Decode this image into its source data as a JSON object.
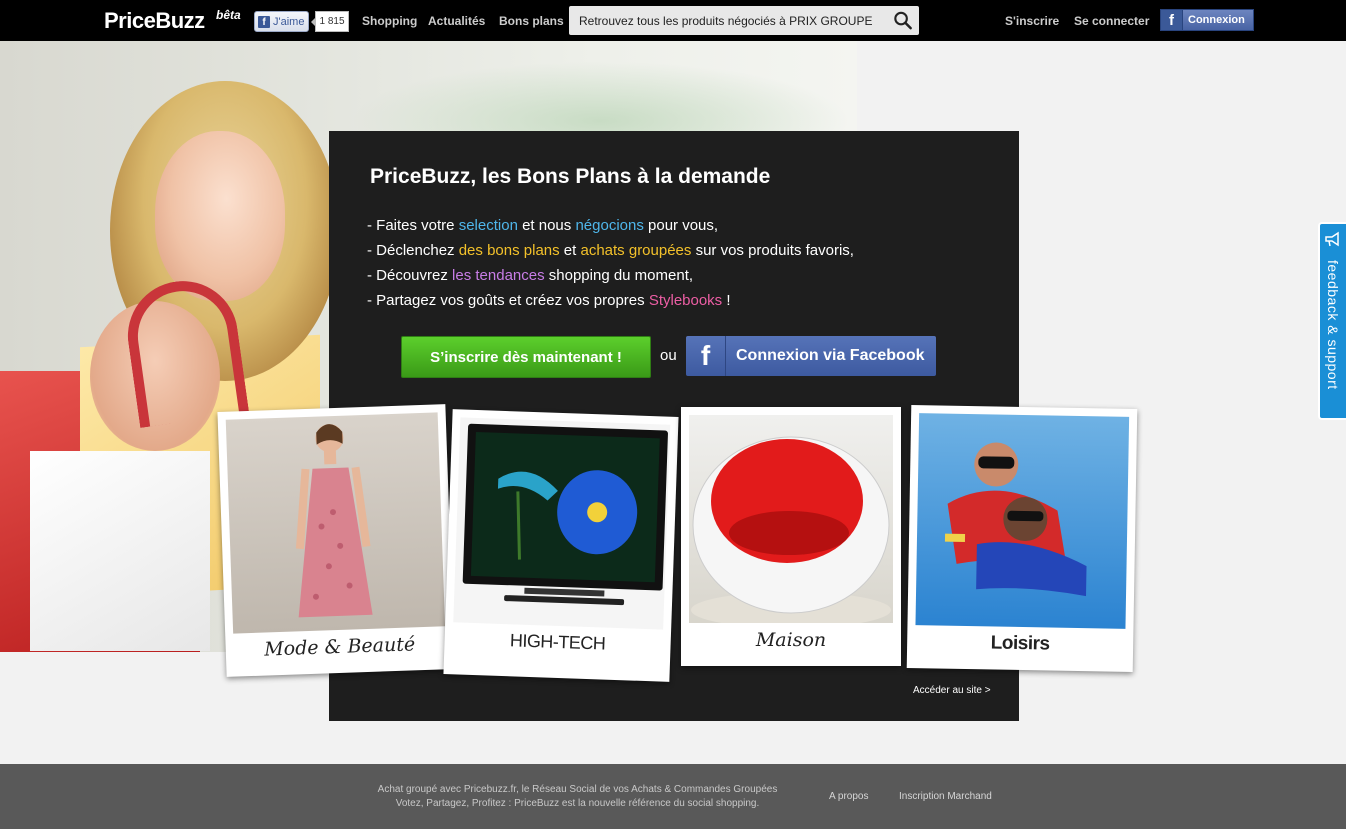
{
  "header": {
    "logo": "PriceBuzz",
    "logo_badge": "bêta",
    "fb_like_label": "J'aime",
    "fb_like_count": "1 815",
    "nav": [
      "Shopping",
      "Actualités",
      "Bons plans"
    ],
    "search_placeholder": "Retrouvez tous les produits négociés à PRIX GROUPE",
    "signup": "S'inscrire",
    "login": "Se connecter",
    "fb_connect": "Connexion"
  },
  "panel": {
    "title": "PriceBuzz, les Bons Plans à la demande",
    "line1": {
      "a": "- Faites votre ",
      "b": "selection",
      "c": " et nous ",
      "d": "négocions",
      "e": " pour vous,"
    },
    "line2": {
      "a": "- Déclenchez ",
      "b": "des bons plans",
      "c": " et ",
      "d": "achats groupées",
      "e": " sur vos produits favoris,"
    },
    "line3": {
      "a": "- Découvrez ",
      "b": "les tendances",
      "c": " shopping du moment,"
    },
    "line4": {
      "a": "- Partagez vos goûts et créez vos propres ",
      "b": "Stylebooks",
      "c": " !"
    },
    "signup_button": "S’inscrire dès maintenant !",
    "or_label": "ou",
    "fb_button": "Connexion via Facebook",
    "access_link": "Accéder au site >"
  },
  "categories": [
    {
      "caption": "Mode & Beauté"
    },
    {
      "caption": "HIGH-TECH"
    },
    {
      "caption": "Maison"
    },
    {
      "caption": "Loisirs"
    }
  ],
  "feedback_tab": "feedback & support",
  "footer": {
    "line1": "Achat groupé avec Pricebuzz.fr, le Réseau Social de vos Achats & Commandes Groupées",
    "line2": "Votez, Partagez, Profitez : PriceBuzz est la nouvelle référence du social shopping.",
    "link_about": "A propos",
    "link_merchant": "Inscription Marchand"
  },
  "colors": {
    "accent_blue": "#4fb6ea",
    "accent_yellow": "#f3c12a",
    "accent_purple": "#c87de6",
    "accent_pink": "#ec5ea4",
    "signup_green": "#4bb322",
    "facebook_blue": "#3b5998"
  }
}
